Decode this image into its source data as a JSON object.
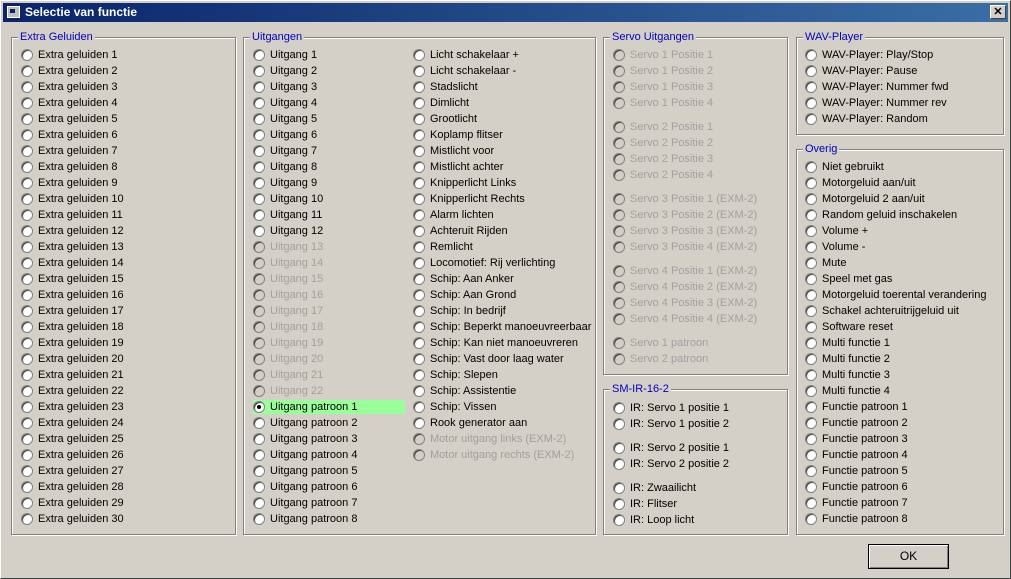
{
  "window": {
    "title": "Selectie van functie",
    "close_glyph": "✕"
  },
  "groups": {
    "extra_geluiden": {
      "title": "Extra Geluiden",
      "items": [
        "Extra geluiden 1",
        "Extra geluiden 2",
        "Extra geluiden 3",
        "Extra geluiden 4",
        "Extra geluiden 5",
        "Extra geluiden 6",
        "Extra geluiden 7",
        "Extra geluiden 8",
        "Extra geluiden 9",
        "Extra geluiden 10",
        "Extra geluiden 11",
        "Extra geluiden 12",
        "Extra geluiden 13",
        "Extra geluiden 14",
        "Extra geluiden 15",
        "Extra geluiden 16",
        "Extra geluiden 17",
        "Extra geluiden 18",
        "Extra geluiden 19",
        "Extra geluiden 20",
        "Extra geluiden 21",
        "Extra geluiden 22",
        "Extra geluiden 23",
        "Extra geluiden 24",
        "Extra geluiden 25",
        "Extra geluiden 26",
        "Extra geluiden 27",
        "Extra geluiden 28",
        "Extra geluiden 29",
        "Extra geluiden 30"
      ]
    },
    "uitgangen": {
      "title": "Uitgangen",
      "col1": [
        "Uitgang 1",
        "Uitgang 2",
        "Uitgang 3",
        "Uitgang 4",
        "Uitgang 5",
        "Uitgang 6",
        "Uitgang 7",
        "Uitgang 8",
        "Uitgang 9",
        "Uitgang 10",
        "Uitgang 11",
        "Uitgang 12",
        "Uitgang 13",
        "Uitgang 14",
        "Uitgang 15",
        "Uitgang 16",
        "Uitgang 17",
        "Uitgang 18",
        "Uitgang 19",
        "Uitgang 20",
        "Uitgang 21",
        "Uitgang 22",
        "Uitgang patroon 1",
        "Uitgang patroon 2",
        "Uitgang patroon 3",
        "Uitgang patroon 4",
        "Uitgang patroon 5",
        "Uitgang patroon 6",
        "Uitgang patroon 7",
        "Uitgang patroon 8"
      ],
      "col2": [
        "Licht schakelaar +",
        "Licht schakelaar -",
        "Stadslicht",
        "Dimlicht",
        "Grootlicht",
        "Koplamp flitser",
        "Mistlicht voor",
        "Mistlicht achter",
        "Knipperlicht Links",
        "Knipperlicht Rechts",
        "Alarm lichten",
        "Achteruit Rijden",
        "Remlicht",
        "Locomotief: Rij verlichting",
        "Schip: Aan Anker",
        "Schip: Aan Grond",
        "Schip: In bedrijf",
        "Schip: Beperkt manoeuvreerbaar",
        "Schip: Kan niet manoeuvreren",
        "Schip: Vast door laag water",
        "Schip: Slepen",
        "Schip: Assistentie",
        "Schip: Vissen",
        "Rook generator aan",
        "Motor uitgang links (EXM-2)",
        "Motor uitgang rechts (EXM-2)"
      ]
    },
    "servo_uitgangen": {
      "title": "Servo Uitgangen",
      "items": [
        "Servo 1 Positie 1",
        "Servo 1 Positie 2",
        "Servo 1 Positie 3",
        "Servo 1 Positie 4",
        "Servo 2 Positie 1",
        "Servo 2 Positie 2",
        "Servo 2 Positie 3",
        "Servo 2 Positie 4",
        "Servo 3 Positie 1 (EXM-2)",
        "Servo 3 Positie 2 (EXM-2)",
        "Servo 3 Positie 3 (EXM-2)",
        "Servo 3 Positie 4 (EXM-2)",
        "Servo 4 Positie 1 (EXM-2)",
        "Servo 4 Positie 2 (EXM-2)",
        "Servo 4 Positie 3 (EXM-2)",
        "Servo 4 Positie 4 (EXM-2)",
        "Servo 1 patroon",
        "Servo 2 patroon"
      ]
    },
    "sm_ir": {
      "title": "SM-IR-16-2",
      "items": [
        "IR: Servo 1 positie 1",
        "IR: Servo 1 positie 2",
        "IR: Servo 2 positie 1",
        "IR: Servo 2 positie 2",
        "IR: Zwaailicht",
        "IR: Flitser",
        "IR: Loop licht"
      ]
    },
    "wav_player": {
      "title": "WAV-Player",
      "items": [
        "WAV-Player: Play/Stop",
        "WAV-Player: Pause",
        "WAV-Player: Nummer fwd",
        "WAV-Player: Nummer rev",
        "WAV-Player: Random"
      ]
    },
    "overig": {
      "title": "Overig",
      "items": [
        "Niet gebruikt",
        "Motorgeluid aan/uit",
        "Motorgeluid 2 aan/uit",
        "Random geluid inschakelen",
        "Volume +",
        "Volume -",
        "Mute",
        "Speel met gas",
        "Motorgeluid toerental verandering",
        "Schakel achteruitrijgeluid uit",
        "Software reset",
        "Multi functie 1",
        "Multi functie 2",
        "Multi functie 3",
        "Multi functie 4",
        "Functie patroon 1",
        "Functie patroon 2",
        "Functie patroon 3",
        "Functie patroon 4",
        "Functie patroon 5",
        "Functie patroon 6",
        "Functie patroon 7",
        "Functie patroon 8"
      ]
    }
  },
  "selected": "Uitgang patroon 1",
  "disabled_note": "greyed options",
  "ok_label": "OK"
}
